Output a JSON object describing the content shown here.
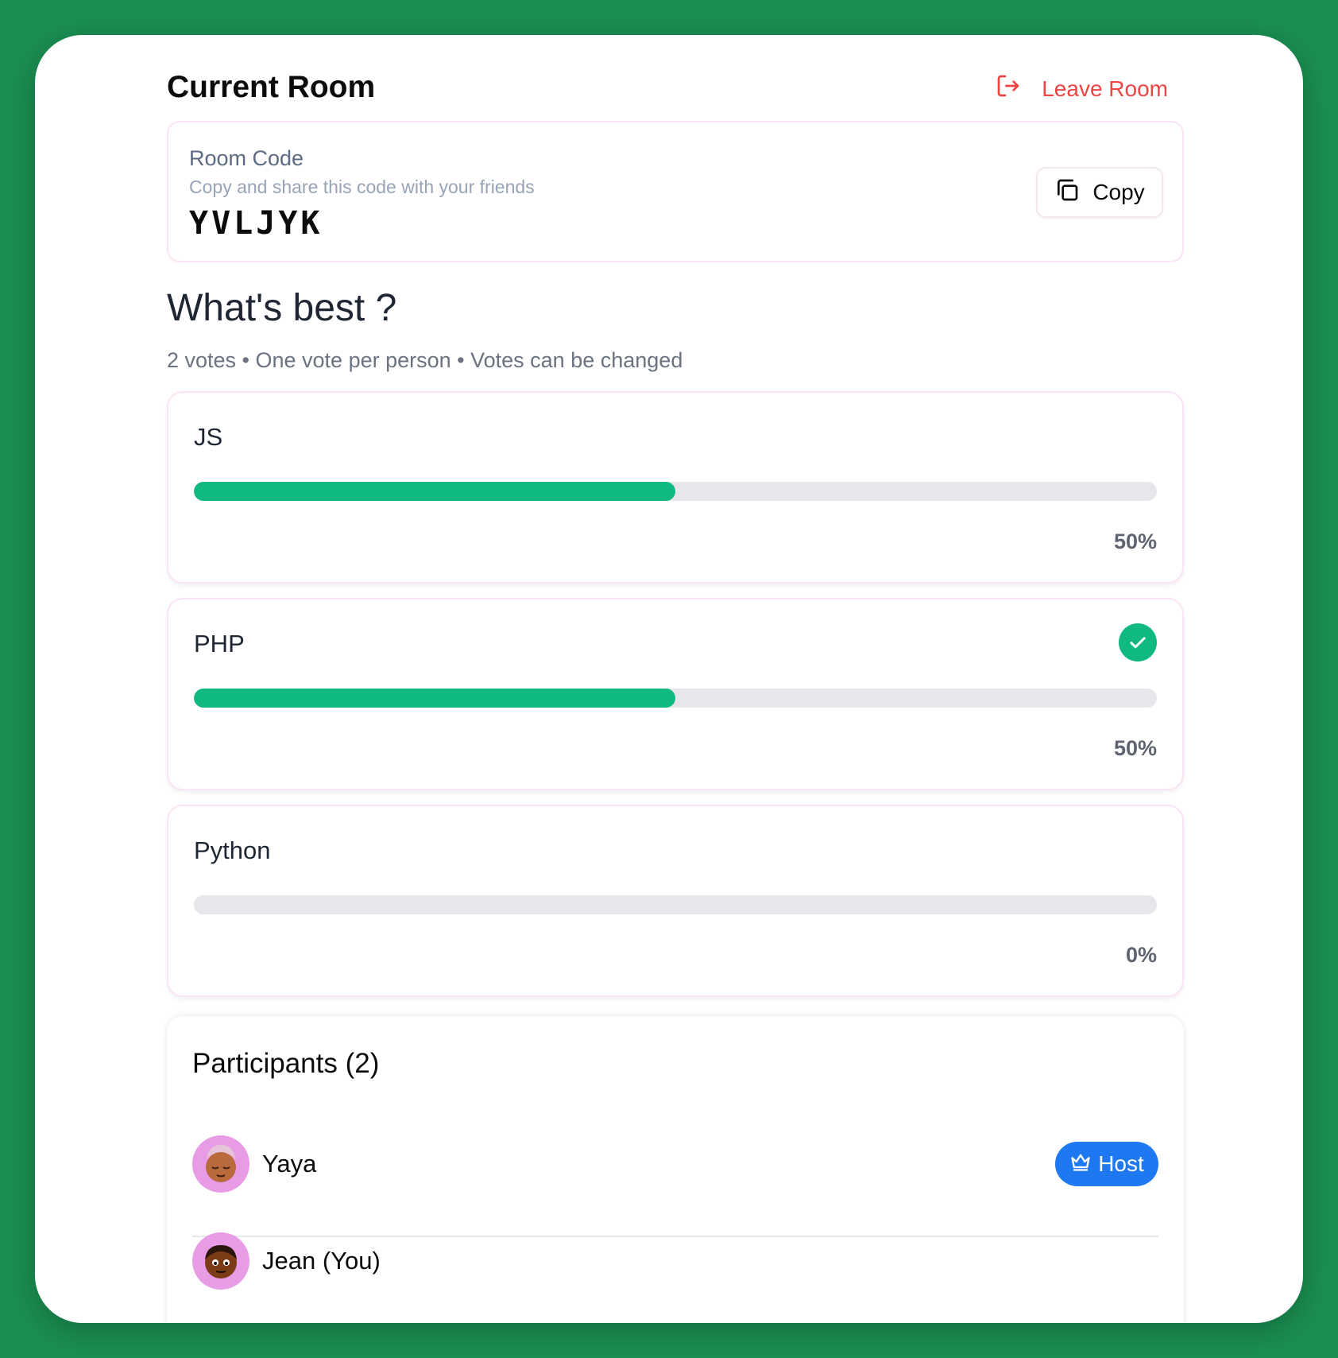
{
  "header": {
    "title": "Current Room",
    "leave_label": "Leave Room"
  },
  "room": {
    "label": "Room Code",
    "subtitle": "Copy and share this code with your friends",
    "code": "YVLJYK",
    "copy_label": "Copy"
  },
  "poll": {
    "question": "What's best ?",
    "meta": "2 votes • One vote per person • Votes can be changed",
    "options": [
      {
        "label": "JS",
        "percent_label": "50%",
        "fill": 0.5,
        "selected": false
      },
      {
        "label": "PHP",
        "percent_label": "50%",
        "fill": 0.5,
        "selected": true
      },
      {
        "label": "Python",
        "percent_label": "0%",
        "fill": 0,
        "selected": false
      }
    ]
  },
  "participants": {
    "title": "Participants (2)",
    "list": [
      {
        "name": "Yaya",
        "badge": "Host"
      },
      {
        "name": "Jean (You)"
      }
    ]
  },
  "colors": {
    "background": "#1b8f52",
    "accent_green": "#10b981",
    "danger": "#ef4444",
    "host_blue": "#1e78f2",
    "avatar_bg": "#e99ce6"
  }
}
